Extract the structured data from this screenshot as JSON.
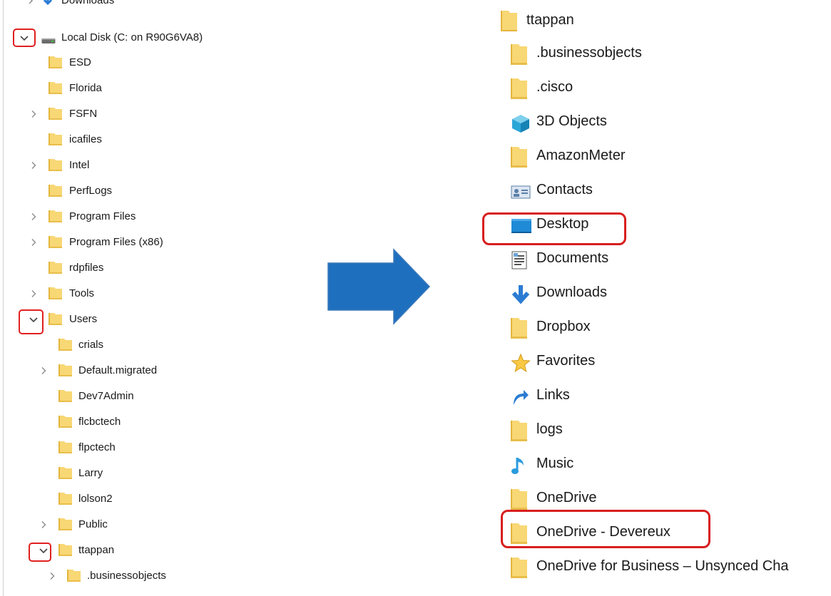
{
  "left_tree": {
    "top_partial_label": "Downloads",
    "drive_label": "Local Disk (C: on R90G6VA8)",
    "drive_children": [
      {
        "label": "ESD",
        "expandable": false
      },
      {
        "label": "Florida",
        "expandable": false
      },
      {
        "label": "FSFN",
        "expandable": true
      },
      {
        "label": "icafiles",
        "expandable": false
      },
      {
        "label": "Intel",
        "expandable": true
      },
      {
        "label": "PerfLogs",
        "expandable": false
      },
      {
        "label": "Program Files",
        "expandable": true
      },
      {
        "label": "Program Files (x86)",
        "expandable": true
      },
      {
        "label": "rdpfiles",
        "expandable": false
      },
      {
        "label": "Tools",
        "expandable": true
      },
      {
        "label": "Users",
        "expandable": true,
        "expanded": true
      }
    ],
    "users_children": [
      {
        "label": "crials",
        "expandable": false
      },
      {
        "label": "Default.migrated",
        "expandable": true
      },
      {
        "label": "Dev7Admin",
        "expandable": false
      },
      {
        "label": "flcbctech",
        "expandable": false
      },
      {
        "label": "flpctech",
        "expandable": false
      },
      {
        "label": "Larry",
        "expandable": false
      },
      {
        "label": "lolson2",
        "expandable": false
      },
      {
        "label": "Public",
        "expandable": true
      },
      {
        "label": "ttappan",
        "expandable": true,
        "expanded": true
      }
    ],
    "ttappan_children": [
      {
        "label": ".businessobjects",
        "expandable": true
      }
    ]
  },
  "right_list": {
    "root": "ttappan",
    "items": [
      {
        "label": ".businessobjects",
        "icon": "folder-icon"
      },
      {
        "label": ".cisco",
        "icon": "folder-icon"
      },
      {
        "label": "3D Objects",
        "icon": "3d-objects-icon"
      },
      {
        "label": "AmazonMeter",
        "icon": "folder-icon"
      },
      {
        "label": "Contacts",
        "icon": "contacts-icon"
      },
      {
        "label": "Desktop",
        "icon": "desktop-icon",
        "highlighted": true
      },
      {
        "label": "Documents",
        "icon": "documents-icon"
      },
      {
        "label": "Downloads",
        "icon": "downloads-icon"
      },
      {
        "label": "Dropbox",
        "icon": "folder-icon"
      },
      {
        "label": "Favorites",
        "icon": "favorites-star-icon"
      },
      {
        "label": "Links",
        "icon": "links-icon"
      },
      {
        "label": "logs",
        "icon": "folder-icon"
      },
      {
        "label": "Music",
        "icon": "music-note-icon"
      },
      {
        "label": "OneDrive",
        "icon": "folder-icon"
      },
      {
        "label": "OneDrive - Devereux",
        "icon": "folder-icon",
        "highlighted": true
      },
      {
        "label": "OneDrive for Business – Unsynced Cha",
        "icon": "folder-icon"
      }
    ]
  },
  "colors": {
    "folder": "#f8d775",
    "folder_dark": "#e3b53c",
    "highlight_red": "#e02020",
    "arrow_blue": "#1f6fbf"
  }
}
